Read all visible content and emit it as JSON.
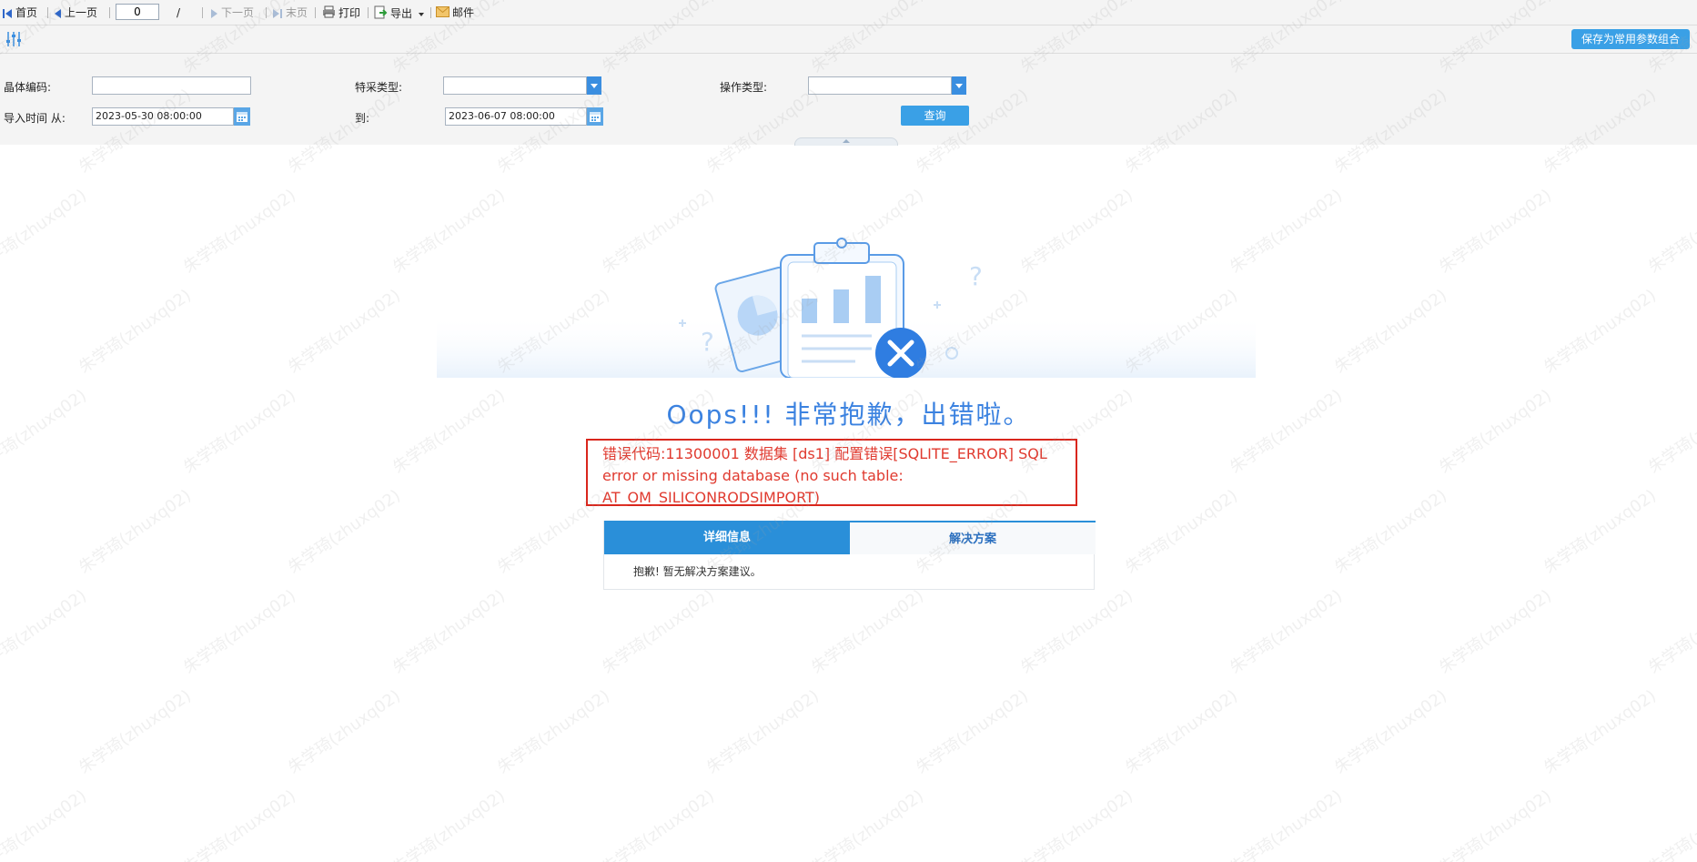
{
  "toolbar": {
    "first": "首页",
    "prev": "上一页",
    "page_value": "0",
    "page_sep": "/",
    "next": "下一页",
    "last": "末页",
    "print": "打印",
    "export": "导出",
    "mail": "邮件"
  },
  "params": {
    "save_label": "保存为常用参数组合",
    "crystal_code_label": "晶体编码:",
    "crystal_code_value": "",
    "special_type_label": "特采类型:",
    "special_type_value": "",
    "op_type_label": "操作类型:",
    "op_type_value": "",
    "import_from_label": "导入时间 从:",
    "import_from_value": "2023-05-30 08:00:00",
    "import_to_label": "到:",
    "import_to_value": "2023-06-07 08:00:00",
    "query_label": "查询"
  },
  "error": {
    "title": "Oops!!! 非常抱歉，出错啦。",
    "message": "错误代码:11300001 数据集 [ds1] 配置错误[SQLITE_ERROR] SQL error or missing database (no such table: AT_OM_SILICONRODSIMPORT)",
    "tab_details": "详细信息",
    "tab_solution": "解决方案",
    "solution_text": "抱歉! 暂无解决方案建议。"
  },
  "watermark": "朱学琦(zhuxq02)",
  "colors": {
    "accent": "#3aa0e6",
    "error": "#d9261c",
    "title": "#3b82e0"
  }
}
